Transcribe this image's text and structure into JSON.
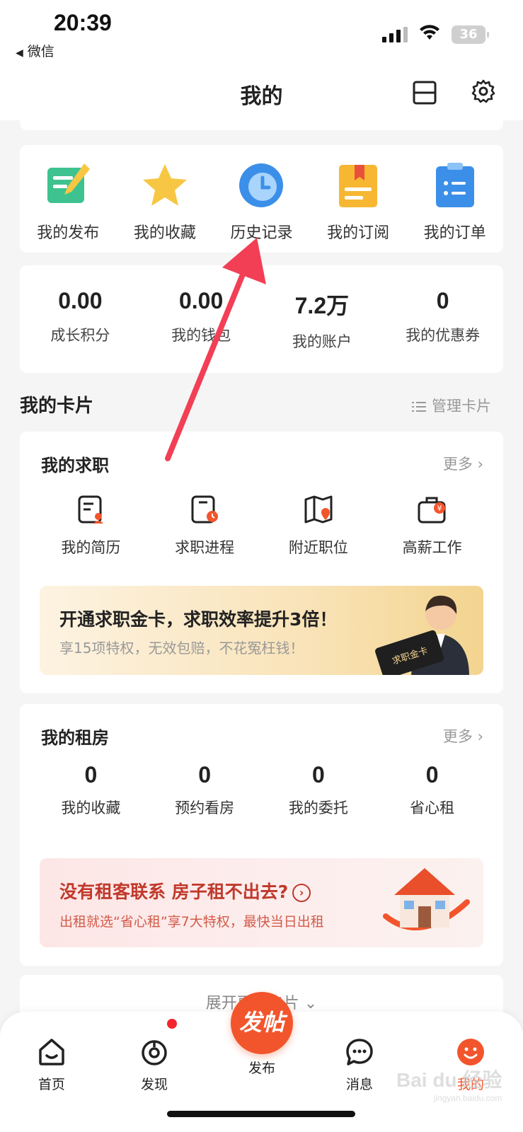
{
  "status_bar": {
    "time": "20:39",
    "back_app": "微信",
    "battery": "36"
  },
  "header": {
    "title": "我的"
  },
  "quick_actions": [
    {
      "label": "我的发布",
      "icon": "edit-note-icon"
    },
    {
      "label": "我的收藏",
      "icon": "star-icon"
    },
    {
      "label": "历史记录",
      "icon": "clock-icon"
    },
    {
      "label": "我的订阅",
      "icon": "bookmark-doc-icon"
    },
    {
      "label": "我的订单",
      "icon": "clipboard-list-icon"
    }
  ],
  "stats": [
    {
      "value": "0.00",
      "label": "成长积分"
    },
    {
      "value": "0.00",
      "label": "我的钱包"
    },
    {
      "value": "7.2万",
      "label": "我的账户"
    },
    {
      "value": "0",
      "label": "我的优惠券"
    }
  ],
  "cards_section": {
    "title": "我的卡片",
    "manage_label": "管理卡片"
  },
  "job_card": {
    "title": "我的求职",
    "more": "更多 ›",
    "items": [
      {
        "label": "我的简历",
        "icon": "resume-icon"
      },
      {
        "label": "求职进程",
        "icon": "progress-clock-icon"
      },
      {
        "label": "附近职位",
        "icon": "map-pin-icon"
      },
      {
        "label": "高薪工作",
        "icon": "briefcase-yen-icon"
      }
    ],
    "banner": {
      "title": "开通求职金卡，求职效率提升3倍！",
      "subtitle": "享15项特权，无效包赔，不花冤枉钱！",
      "card_text": "求职金卡"
    }
  },
  "rent_card": {
    "title": "我的租房",
    "more": "更多 ›",
    "items": [
      {
        "value": "0",
        "label": "我的收藏"
      },
      {
        "value": "0",
        "label": "预约看房"
      },
      {
        "value": "0",
        "label": "我的委托"
      },
      {
        "value": "0",
        "label": "省心租"
      }
    ],
    "banner": {
      "title": "没有租客联系 房子租不出去?",
      "arrow": "›",
      "subtitle": "出租就选“省心租”享7大特权，最快当日出租"
    }
  },
  "expand_label": "展开更多卡片 ⌄",
  "tab_bar": {
    "tabs": [
      {
        "label": "首页",
        "icon": "home-icon"
      },
      {
        "label": "发现",
        "icon": "discover-icon"
      },
      {
        "label": "发布",
        "icon": "publish-icon"
      },
      {
        "label": "消息",
        "icon": "message-icon"
      },
      {
        "label": "我的",
        "icon": "profile-icon"
      }
    ],
    "publish_button": "发帖",
    "active_color": "#f2552c"
  },
  "watermark": {
    "main": "Bai du 经验",
    "sub": "jingyan.baidu.com"
  }
}
